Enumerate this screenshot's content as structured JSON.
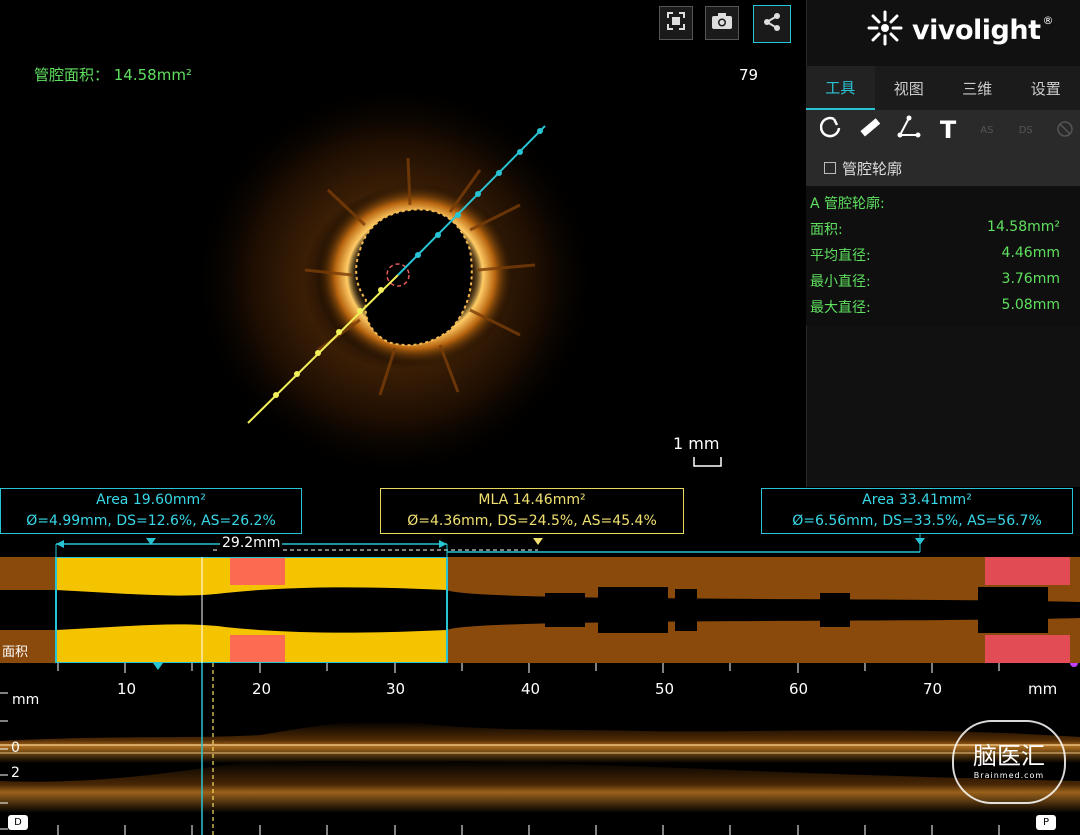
{
  "oct": {
    "lumen_area_label": "管腔面积：  14.58mm²",
    "frame_number": "79",
    "scale_label": "1 mm",
    "toolbar": {
      "fullscreen": "fullscreen-icon",
      "snapshot": "camera-icon",
      "share": "share-icon"
    }
  },
  "brand": {
    "name": "vivolight",
    "mark": "®"
  },
  "tabs": [
    "工具",
    "视图",
    "三维",
    "设置"
  ],
  "tools": {
    "icons": [
      "lumen-contour-icon",
      "ruler-icon",
      "angle-icon",
      "text-icon",
      "as-icon",
      "ds-icon",
      "clear-icon"
    ],
    "text_tool": "T",
    "as_label": "AS",
    "ds_label": "DS"
  },
  "lumen_contour_checkbox": {
    "label": "管腔轮廓",
    "checked": false
  },
  "measurements": {
    "title": "A 管腔轮廓:",
    "rows": [
      {
        "label": "面积:",
        "value": "14.58mm²"
      },
      {
        "label": "平均直径:",
        "value": "4.46mm"
      },
      {
        "label": "最小直径:",
        "value": "3.76mm"
      },
      {
        "label": "最大直径:",
        "value": "5.08mm"
      }
    ]
  },
  "info_boxes": {
    "left": {
      "line1": "Area 19.60mm²",
      "line2": "Ø=4.99mm, DS=12.6%, AS=26.2%"
    },
    "mla": {
      "line1": "MLA 14.46mm²",
      "line2": "Ø=4.36mm, DS=24.5%, AS=45.4%"
    },
    "right": {
      "line1": "Area 33.41mm²",
      "line2": "Ø=6.56mm, DS=33.5%, AS=56.7%"
    }
  },
  "segment_length": "29.2mm",
  "longitudinal": {
    "label": "面积",
    "ticks": [
      "10",
      "20",
      "30",
      "40",
      "50",
      "60",
      "70"
    ],
    "unit": "mm",
    "depth_unit": "mm",
    "depth_ticks": [
      "0",
      "2"
    ],
    "end_left": "D",
    "end_right": "P"
  },
  "watermark": {
    "text": "脑医汇",
    "sub": "Brainmed.com"
  },
  "colors": {
    "accent": "#29c4d4",
    "green": "#5fe05f",
    "yellow": "#f5c400",
    "orange": "#8a4a0c",
    "stent": "#ff4d6d"
  }
}
